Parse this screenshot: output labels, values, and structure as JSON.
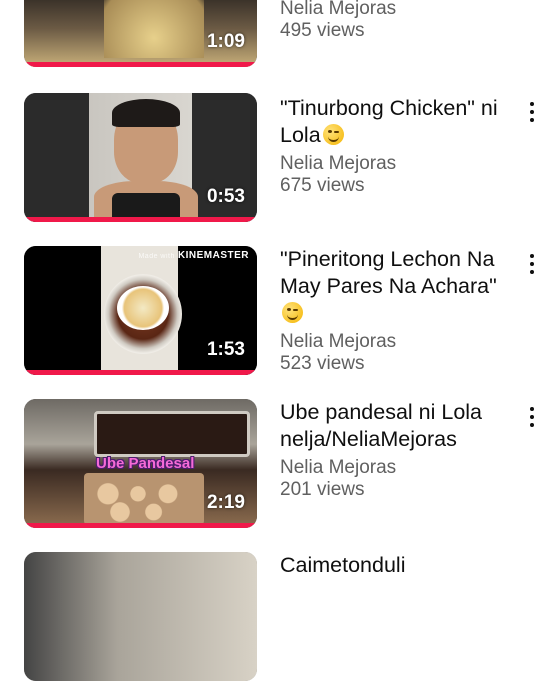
{
  "videos": [
    {
      "title": "",
      "channel": "Nelia Mejoras",
      "views": "495 views",
      "duration": "1:09",
      "progress_fraction": 1.0
    },
    {
      "title": "\"Tinurbong Chicken\" ni Lola",
      "title_emoji": "wink-emoji",
      "channel": "Nelia Mejoras",
      "views": "675 views",
      "duration": "0:53",
      "progress_fraction": 1.0
    },
    {
      "title": "\"Pineritong Lechon Na May Pares Na Achara\"",
      "title_emoji": "wink-emoji",
      "channel": "Nelia Mejoras",
      "views": "523 views",
      "duration": "1:53",
      "watermark_prefix": "Made with",
      "watermark": "KINEMASTER",
      "progress_fraction": 1.0
    },
    {
      "title": "Ube pandesal ni Lola nelja/NeliaMejoras",
      "channel": "Nelia Mejoras",
      "views": "201 views",
      "duration": "2:19",
      "overlay_text": "Ube Pandesal",
      "progress_fraction": 1.0
    }
  ],
  "partial_next_title": "Caimetonduli",
  "colors": {
    "progress": "#f0194a",
    "title": "#0f0f0f",
    "meta": "#606060"
  }
}
